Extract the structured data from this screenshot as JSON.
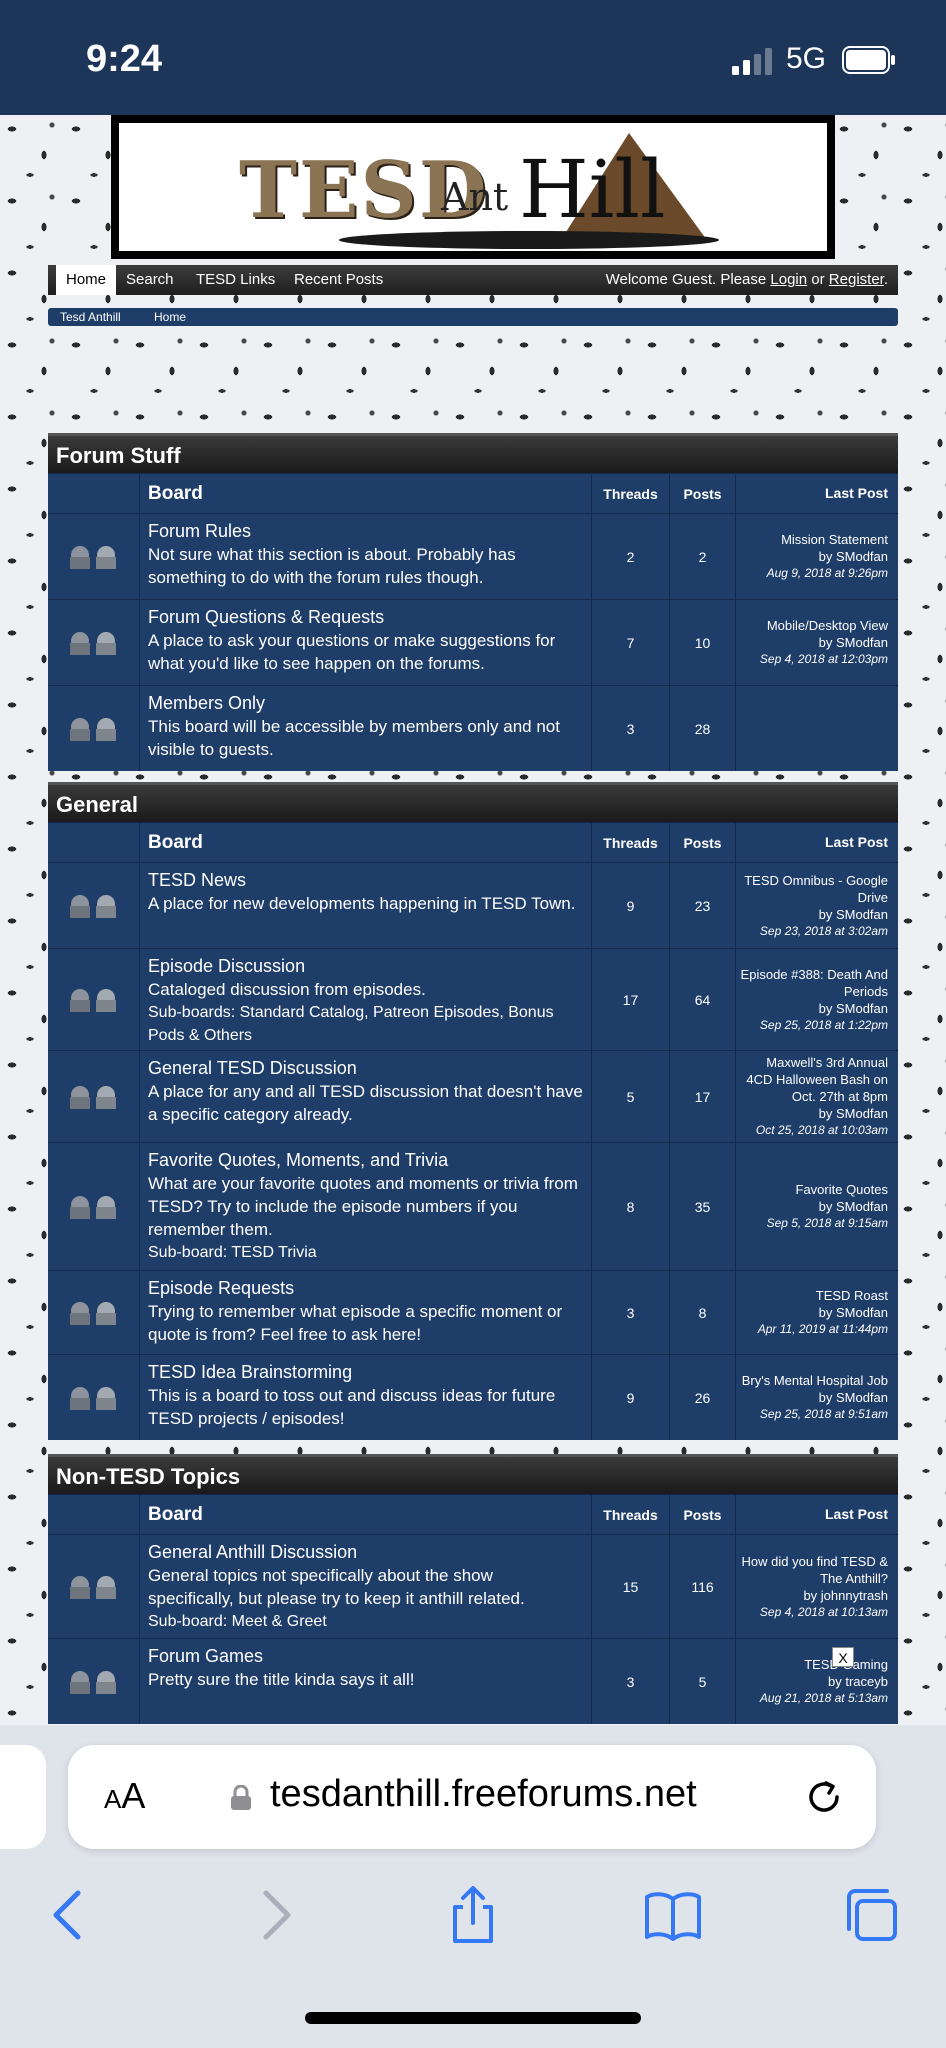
{
  "status_bar": {
    "time": "9:24",
    "network": "5G"
  },
  "site": {
    "logo_tesd": "TESD",
    "logo_ant": "Ant",
    "logo_hill": "Hill",
    "nav": {
      "home": "Home",
      "search": "Search",
      "links": "TESD Links",
      "recent": "Recent Posts"
    },
    "welcome_prefix": "Welcome Guest. Please",
    "login": "Login",
    "or": "or",
    "register": "Register",
    "period": ".",
    "breadcrumb": [
      "Tesd Anthill",
      "Home"
    ]
  },
  "headers": {
    "board": "Board",
    "threads": "Threads",
    "posts": "Posts",
    "last_post": "Last Post"
  },
  "categories": [
    {
      "title": "Forum Stuff",
      "boards": [
        {
          "name": "Forum Rules",
          "desc": "Not sure what this section is about. Probably has something to do with the forum rules though.",
          "sub": "",
          "threads": "2",
          "posts": "2",
          "last_title": "Mission Statement",
          "last_by": "by SModfan",
          "last_date": "Aug 9, 2018 at 9:26pm"
        },
        {
          "name": "Forum Questions & Requests",
          "desc": "A place to ask your questions or make suggestions for what you'd like to see happen on the forums.",
          "sub": "",
          "threads": "7",
          "posts": "10",
          "last_title": "Mobile/Desktop View",
          "last_by": "by SModfan",
          "last_date": "Sep 4, 2018 at 12:03pm"
        },
        {
          "name": "Members Only",
          "desc": "This board will be accessible by members only and not visible to guests.",
          "sub": "",
          "threads": "3",
          "posts": "28",
          "last_title": "",
          "last_by": "",
          "last_date": ""
        }
      ]
    },
    {
      "title": "General",
      "boards": [
        {
          "name": "TESD News",
          "desc": "A place for new developments happening in TESD Town.",
          "sub": "",
          "threads": "9",
          "posts": "23",
          "last_title": "TESD Omnibus - Google Drive",
          "last_by": "by SModfan",
          "last_date": "Sep 23, 2018 at 3:02am"
        },
        {
          "name": "Episode Discussion",
          "desc": "Cataloged discussion from episodes.",
          "sub": "Sub-boards: Standard Catalog, Patreon Episodes, Bonus Pods & Others",
          "threads": "17",
          "posts": "64",
          "last_title": "Episode #388: Death And Periods",
          "last_by": "by SModfan",
          "last_date": "Sep 25, 2018 at 1:22pm"
        },
        {
          "name": "General TESD Discussion",
          "desc": "A place for any and all TESD discussion that doesn't have a specific category already.",
          "sub": "",
          "threads": "5",
          "posts": "17",
          "last_title": "Maxwell's 3rd Annual 4CD Halloween Bash on Oct. 27th at 8pm",
          "last_by": "by SModfan",
          "last_date": "Oct 25, 2018 at 10:03am"
        },
        {
          "name": "Favorite Quotes, Moments, and Trivia",
          "desc": "What are your favorite quotes and moments or trivia from TESD? Try to include the episode numbers if you remember them.",
          "sub": "Sub-board: TESD Trivia",
          "threads": "8",
          "posts": "35",
          "last_title": "Favorite Quotes",
          "last_by": "by SModfan",
          "last_date": "Sep 5, 2018 at 9:15am"
        },
        {
          "name": "Episode Requests",
          "desc": "Trying to remember what episode a specific moment or quote is from? Feel free to ask here!",
          "sub": "",
          "threads": "3",
          "posts": "8",
          "last_title": "TESD Roast",
          "last_by": "by SModfan",
          "last_date": "Apr 11, 2019 at 11:44pm"
        },
        {
          "name": "TESD Idea Brainstorming",
          "desc": "This is a board to toss out and discuss ideas for future TESD projects / episodes!",
          "sub": "",
          "threads": "9",
          "posts": "26",
          "last_title": "Bry's Mental Hospital Job",
          "last_by": "by SModfan",
          "last_date": "Sep 25, 2018 at 9:51am"
        }
      ]
    },
    {
      "title": "Non-TESD Topics",
      "boards": [
        {
          "name": "General Anthill Discussion",
          "desc": "General topics not specifically about the show specifically, but please try to keep it anthill related.",
          "sub": "Sub-board: Meet & Greet",
          "threads": "15",
          "posts": "116",
          "last_title": "How did you find TESD & The Anthill?",
          "last_by": "by johnnytrash",
          "last_date": "Sep 4, 2018 at 10:13am"
        },
        {
          "name": "Forum Games",
          "desc": "Pretty sure the title kinda says it all!",
          "sub": "",
          "threads": "3",
          "posts": "5",
          "last_title": "TESD Gaming",
          "last_by": "by traceyb",
          "last_date": "Aug 21, 2018 at 5:13am"
        }
      ]
    }
  ],
  "ad_close": "X",
  "browser": {
    "aa_small": "A",
    "aa_large": "A",
    "url": "tesdanthill.freeforums.net"
  },
  "colors": {
    "accent": "#1e3d68",
    "safari_blue": "#3478f6"
  }
}
